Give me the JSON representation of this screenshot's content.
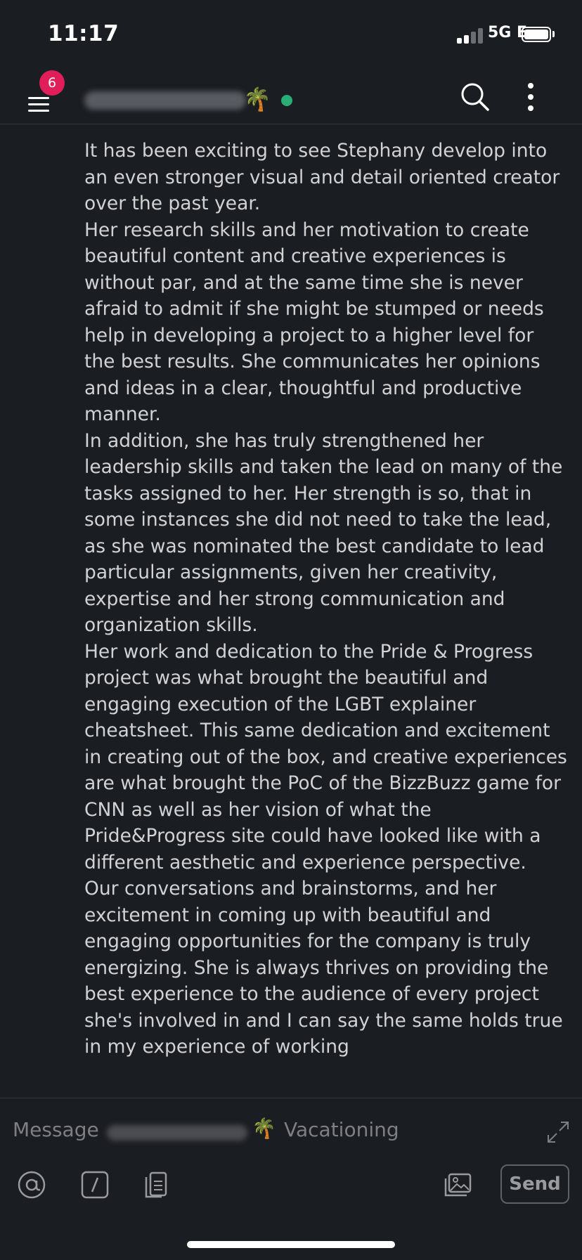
{
  "status_bar": {
    "time": "11:17",
    "network": "5G E"
  },
  "header": {
    "unread_badge": "6",
    "channel_emoji": "🌴",
    "presence": "online"
  },
  "message": {
    "paragraphs": [
      "It has been exciting to see Stephany develop into an even stronger visual and detail oriented creator over the past year.",
      "Her research skills and her motivation to create beautiful content and creative experiences is without par, and at the same time she is never afraid to admit if she might be stumped or needs help in developing a project to a higher level for the best results. She communicates her opinions and ideas in a clear, thoughtful and productive manner.",
      "In addition, she has truly strengthened her leadership skills and taken the lead on many of the tasks assigned to her. Her strength is so, that in some instances she did not need to take the lead, as she was nominated the best candidate to lead particular assignments, given her creativity, expertise and her strong communication and organization skills.",
      "Her work and dedication to the Pride & Progress project was what brought the beautiful and engaging execution of the LGBT explainer cheatsheet. This same dedication and excitement in creating out of the box, and creative experiences are what brought the PoC of the BizzBuzz game for CNN as well as her vision of what the Pride&Progress site could have looked like with a different aesthetic and experience perspective.",
      "Our conversations and brainstorms, and her excitement in coming up with beautiful and engaging opportunities for the company is truly energizing. She is always thrives on providing the best experience to the audience of every project she's involved in and I can say the same holds true in my experience of working"
    ]
  },
  "composer": {
    "placeholder_prefix": "Message",
    "status_emoji": "🌴",
    "status_text": "Vacationing",
    "send_label": "Send"
  },
  "icons": {
    "mention": "at-sign-icon",
    "slash": "slash-command-icon",
    "attach": "clipboard-icon",
    "image": "image-icon",
    "expand": "expand-icon"
  },
  "colors": {
    "background": "#1a1d21",
    "badge": "#e01e5a",
    "presence": "#2bac76"
  }
}
